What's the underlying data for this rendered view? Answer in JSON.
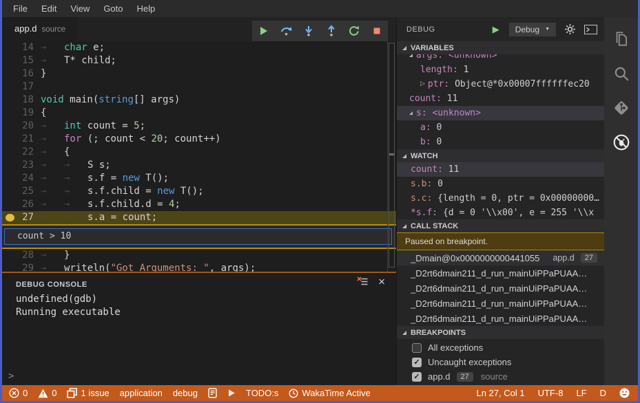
{
  "menu_bar": {
    "items": [
      "File",
      "Edit",
      "View",
      "Goto",
      "Help"
    ]
  },
  "editor_tab": {
    "name": "app.d",
    "type_hint": "source"
  },
  "debug_toolbar": {
    "buttons": [
      {
        "name": "continue",
        "color": "#89d185"
      },
      {
        "name": "step-over",
        "color": "#75beff"
      },
      {
        "name": "step-into",
        "color": "#75beff"
      },
      {
        "name": "step-out",
        "color": "#75beff"
      },
      {
        "name": "restart",
        "color": "#89d185"
      },
      {
        "name": "stop",
        "color": "#f48771"
      }
    ]
  },
  "editor": {
    "current_line": 27,
    "breakpoint_line": 27,
    "condition_input": {
      "value": "count > 10",
      "after_line": 27
    },
    "lines": [
      {
        "n": 14,
        "indent": 1,
        "tokens": [
          [
            "char",
            "kw"
          ],
          [
            " e;",
            "def"
          ]
        ]
      },
      {
        "n": 15,
        "indent": 1,
        "tokens": [
          [
            "T* child;",
            "def"
          ]
        ]
      },
      {
        "n": 16,
        "indent": 0,
        "tokens": [
          [
            "}",
            "def"
          ]
        ]
      },
      {
        "n": 17,
        "indent": 0,
        "tokens": []
      },
      {
        "n": 18,
        "indent": 0,
        "tokens": [
          [
            "void",
            "kw"
          ],
          [
            " main(",
            "def"
          ],
          [
            "string",
            "kw2"
          ],
          [
            "[] args)",
            "def"
          ]
        ]
      },
      {
        "n": 19,
        "indent": 0,
        "tokens": [
          [
            "{",
            "def"
          ]
        ]
      },
      {
        "n": 20,
        "indent": 1,
        "tokens": [
          [
            "int",
            "kw"
          ],
          [
            " count = ",
            "def"
          ],
          [
            "5",
            "num"
          ],
          [
            ";",
            "def"
          ]
        ]
      },
      {
        "n": 21,
        "indent": 1,
        "tokens": [
          [
            "for",
            "ctrl"
          ],
          [
            " (; count < ",
            "def"
          ],
          [
            "20",
            "num"
          ],
          [
            "; count++)",
            "def"
          ]
        ]
      },
      {
        "n": 22,
        "indent": 1,
        "tokens": [
          [
            "{",
            "def"
          ]
        ]
      },
      {
        "n": 23,
        "indent": 2,
        "tokens": [
          [
            "S s;",
            "def"
          ]
        ]
      },
      {
        "n": 24,
        "indent": 2,
        "tokens": [
          [
            "s.f = ",
            "def"
          ],
          [
            "new",
            "kw2"
          ],
          [
            " T();",
            "def"
          ]
        ]
      },
      {
        "n": 25,
        "indent": 2,
        "tokens": [
          [
            "s.f.child = ",
            "def"
          ],
          [
            "new",
            "kw2"
          ],
          [
            " T();",
            "def"
          ]
        ]
      },
      {
        "n": 26,
        "indent": 2,
        "tokens": [
          [
            "s.f.child.d = ",
            "def"
          ],
          [
            "4",
            "num"
          ],
          [
            ";",
            "def"
          ]
        ]
      },
      {
        "n": 27,
        "indent": 2,
        "tokens": [
          [
            "s.a = count;",
            "def"
          ]
        ]
      },
      {
        "n": 28,
        "indent": 1,
        "tokens": [
          [
            "}",
            "def"
          ]
        ]
      },
      {
        "n": 29,
        "indent": 1,
        "tokens": [
          [
            "writeln(",
            "def"
          ],
          [
            "\"Got Arguments: \"",
            "str"
          ],
          [
            ", args);",
            "def"
          ]
        ]
      }
    ]
  },
  "debug_console": {
    "title": "DEBUG CONSOLE",
    "lines": [
      "undefined(gdb)",
      "Running executable"
    ],
    "prompt": ">"
  },
  "debug_sidebar": {
    "title": "DEBUG",
    "config_dropdown": {
      "value": "Debug"
    },
    "variables": {
      "label": "VARIABLES",
      "rows": [
        {
          "name": "args",
          "value": "<unknown>",
          "arrow": "expanded",
          "depth": 1,
          "partial": true
        },
        {
          "name": "length",
          "value": "1",
          "depth": 2
        },
        {
          "name": "ptr",
          "value": "Object@*0x00007ffffffec20",
          "arrow": "collapsed",
          "depth": 2
        },
        {
          "name": "count",
          "value": "11",
          "depth": 1
        },
        {
          "name": "s",
          "value": "<unknown>",
          "arrow": "expanded",
          "depth": 1,
          "selected": true
        },
        {
          "name": "a",
          "value": "0",
          "depth": 2
        },
        {
          "name": "b",
          "value": "0",
          "depth": 2
        }
      ]
    },
    "watch": {
      "label": "WATCH",
      "rows": [
        {
          "name": "count",
          "value": "11",
          "selected": true
        },
        {
          "name": "s.b",
          "value": "0",
          "nc": "o"
        },
        {
          "name": "s.c",
          "value": "{length = 0, ptr = 0x00000000…",
          "nc": "o"
        },
        {
          "name": "*s.f",
          "value": "{d = 0 '\\\\x00', e = 255 '\\\\x",
          "clipped": true
        }
      ]
    },
    "call_stack": {
      "label": "CALL STACK",
      "status": "Paused on breakpoint.",
      "frames": [
        {
          "fn": "_Dmain@0x0000000000441055",
          "file": "app.d",
          "line": "27",
          "selected": true
        },
        {
          "fn": "_D2rt6dmain211_d_run_mainUiPPaPUAA…"
        },
        {
          "fn": "_D2rt6dmain211_d_run_mainUiPPaPUAA…"
        },
        {
          "fn": "_D2rt6dmain211_d_run_mainUiPPaPUAA…"
        },
        {
          "fn": "_D2rt6dmain211_d_run_mainUiPPaPUAA…"
        }
      ]
    },
    "breakpoints": {
      "label": "BREAKPOINTS",
      "rows": [
        {
          "checked": false,
          "label": "All exceptions"
        },
        {
          "checked": true,
          "label": "Uncaught exceptions"
        },
        {
          "checked": true,
          "label": "app.d",
          "badge": "27",
          "hint": "source"
        }
      ]
    }
  },
  "activity_bar": {
    "icons": [
      {
        "name": "explorer",
        "active": false
      },
      {
        "name": "search",
        "active": false
      },
      {
        "name": "source-control",
        "active": false
      },
      {
        "name": "debug",
        "active": true
      }
    ]
  },
  "status_bar": {
    "left": [
      {
        "name": "errors",
        "icon": "error-icon",
        "text": "0"
      },
      {
        "name": "warnings",
        "icon": "warning-icon",
        "text": "0"
      },
      {
        "name": "issues",
        "icon": "issues-icon",
        "text": "1 issue"
      },
      {
        "name": "application",
        "text": "application"
      },
      {
        "name": "debug-config",
        "text": "debug"
      },
      {
        "name": "file-note",
        "icon": "file-note-icon",
        "text": ""
      },
      {
        "name": "run",
        "icon": "play-icon",
        "text": ""
      },
      {
        "name": "todos",
        "text": "TODO:s"
      },
      {
        "name": "wakatime",
        "icon": "clock-icon",
        "text": "WakaTime Active"
      }
    ],
    "right": [
      {
        "name": "cursor-position",
        "text": "Ln 27, Col 1"
      },
      {
        "name": "encoding",
        "text": "UTF-8"
      },
      {
        "name": "eol",
        "text": "LF"
      },
      {
        "name": "language-mode",
        "text": "D"
      },
      {
        "name": "feedback",
        "icon": "smiley-icon",
        "text": ""
      }
    ]
  },
  "colors": {
    "window_border": "#4a5ec9",
    "statusbar": "#c4591c",
    "current_line_bg": "#4c4616",
    "breakpoint_dot": "#e5bd42",
    "condition_border": "#bd8b0e",
    "paused_banner_border": "#b8860b",
    "toolbar_bg": "#343435"
  }
}
